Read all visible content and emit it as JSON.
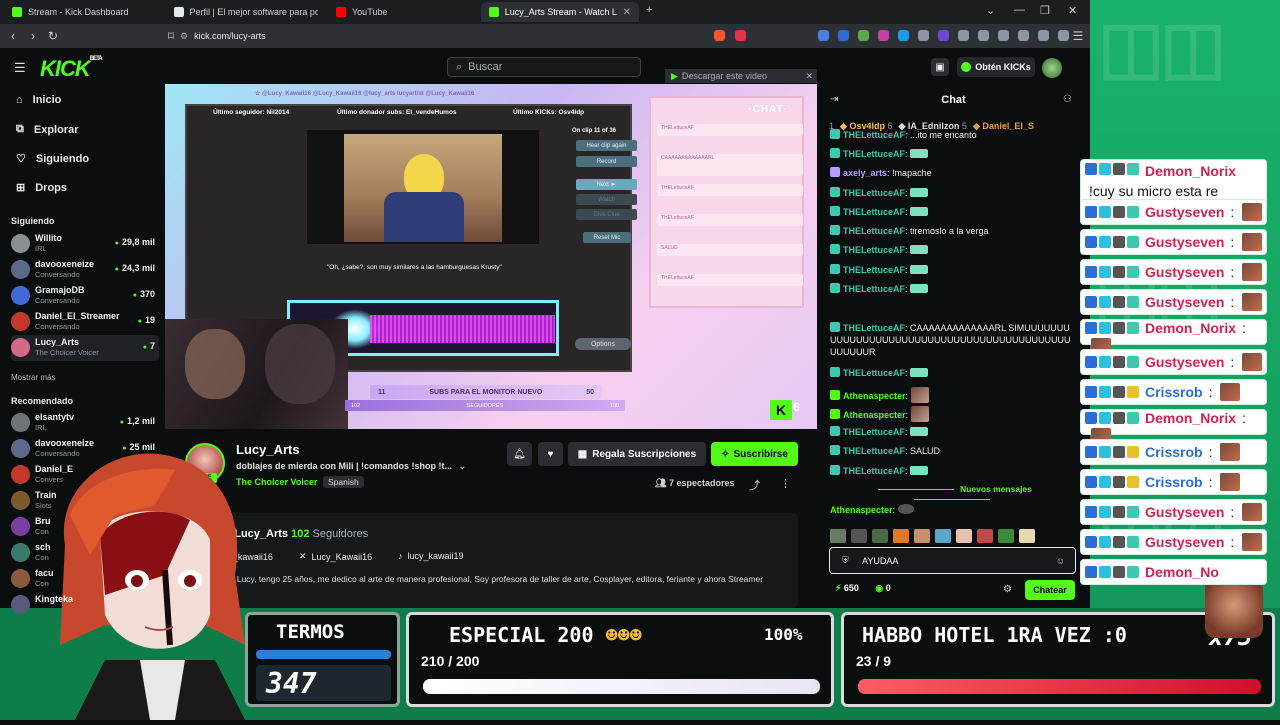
{
  "browser": {
    "tabs": [
      {
        "label": "Stream - Kick Dashboard",
        "color": "#53fc18"
      },
      {
        "label": "Perfil | El mejor software para potenc",
        "color": "#e8e8e8"
      },
      {
        "label": "YouTube",
        "color": "#ff0000"
      },
      {
        "label": "Lucy_Arts Stream - Watch Live",
        "color": "#53fc18"
      }
    ],
    "url": "kick.com/lucy-arts"
  },
  "header": {
    "logo": "KICK",
    "logo_badge": "BETA",
    "search_placeholder": "Buscar",
    "get_kicks": "Obtén KICKs"
  },
  "sidebar": {
    "nav": [
      {
        "label": "Inicio",
        "icon": "home-icon"
      },
      {
        "label": "Explorar",
        "icon": "compass-icon"
      },
      {
        "label": "Siguiendo",
        "icon": "heart-icon"
      },
      {
        "label": "Drops",
        "icon": "gift-icon"
      }
    ],
    "following_title": "Siguiendo",
    "following": [
      {
        "name": "Willito",
        "sub": "IRL",
        "viewers": "29,8 mil",
        "color": "#8a8f94"
      },
      {
        "name": "davooxeneize",
        "sub": "Conversando",
        "viewers": "24,3 mil",
        "color": "#5a6a88"
      },
      {
        "name": "GramajoDB",
        "sub": "Conversando",
        "viewers": "370",
        "color": "#3f6ad8"
      },
      {
        "name": "Daniel_El_Streamer",
        "sub": "Conversando",
        "viewers": "19",
        "color": "#c0392b"
      },
      {
        "name": "Lucy_Arts",
        "sub": "The Choicer Voicer",
        "viewers": "7",
        "color": "#d46a8a"
      }
    ],
    "show_more": "Mostrar más",
    "recommended_title": "Recomendado",
    "recommended": [
      {
        "name": "elsantytv",
        "sub": "IRL",
        "viewers": "1,2 mil",
        "color": "#6e7378"
      },
      {
        "name": "davooxeneize",
        "sub": "Conversando",
        "viewers": "25 mil",
        "color": "#5a6a88"
      },
      {
        "name": "Daniel_E",
        "sub": "Convers",
        "viewers": "",
        "color": "#c0392b"
      },
      {
        "name": "Train",
        "sub": "Slots",
        "viewers": "",
        "color": "#7b5a2d"
      },
      {
        "name": "Bru",
        "sub": "Con",
        "viewers": "",
        "color": "#7a3f9e"
      },
      {
        "name": "sch",
        "sub": "Con",
        "viewers": "",
        "color": "#3a7a6a"
      },
      {
        "name": "facu",
        "sub": "Con",
        "viewers": "",
        "color": "#8a5a3a"
      },
      {
        "name": "Kingteka",
        "sub": "",
        "viewers": "",
        "color": "#5a5a7a"
      }
    ]
  },
  "video": {
    "download": "Descargar este video",
    "handles_top": "☆ @Lucy_Kawaii16  @Lucy_Kawaii16  @lucy_arts  lucyartist  @Lucy_Kawaii16",
    "last_follower": "Último seguidor: Nil2014",
    "last_donor": "Último donador subs: El_vendeHumos",
    "last_kicks": "Último KICKs: Osv4ldp",
    "clip_counter": "On clip 11 of 36",
    "clip_buttons": [
      "Hear clip again",
      "Record",
      "Next ►",
      "Watch",
      "Give Clue",
      "Reset Mic"
    ],
    "subtitle": "\"Oh, ¿sabe?, son muy similares a las hamburguesas Krusty\"",
    "chat_label": "·CHAT·",
    "overlay_chat": [
      "THELettuceAF",
      "CAAAAAAAAAAAAARL",
      "THELettuceAF",
      "THELettuceAF",
      "SALUD",
      "THELettuceAF"
    ],
    "options": "Options",
    "subs_goal_label": "SUBS PARA EL MONITOR NUEVO",
    "subs_goal_current": "11",
    "subs_goal_target": "50",
    "sub_bar_left": "102",
    "sub_bar_mid": "SEGUIDORES",
    "sub_bar_right": "100",
    "kick_badge": "6"
  },
  "channel": {
    "name": "Lucy_Arts",
    "title": "doblajes de mierda con Mili | !comandos !shop !t...",
    "category": "The Choicer Voicer",
    "language": "Spanish",
    "live": "LIVE",
    "gift_label": "Regala Suscripciones",
    "subscribe_label": "Suscribirse",
    "viewers": "7 espectadores",
    "about_prefix": "Sobre Lucy_Arts",
    "followers_count": "102",
    "followers_label": "Seguidores",
    "socials": [
      {
        "icon": "instagram-icon",
        "handle": "lucy_kawaii16"
      },
      {
        "icon": "x-icon",
        "handle": "Lucy_Kawaii16"
      },
      {
        "icon": "tiktok-icon",
        "handle": "lucy_kawaii19"
      }
    ],
    "bio": "Me llamo Lucy, tengo 25 años, me dedico al arte de manera profesional, Soy profesora de taller de arte, Cosplayer, editora, feriante y ahora Streamer"
  },
  "chat": {
    "title": "Chat",
    "leaderboard": [
      {
        "name": "1",
        "amount": ""
      },
      {
        "name": "Osv4ldp",
        "amount": "6"
      },
      {
        "name": "IA_Ednilzon",
        "amount": "5"
      },
      {
        "name": "Daniel_El_S",
        "amount": ""
      }
    ],
    "messages": [
      {
        "user": "THELettuceAF",
        "text": "...ito me encanto",
        "color": "#3ec8b0"
      },
      {
        "user": "THELettuceAF",
        "text": "",
        "emote": true,
        "color": "#3ec8b0"
      },
      {
        "user": "axely_arts",
        "text": "!mapache",
        "color": "#b79cff"
      },
      {
        "user": "THELettuceAF",
        "text": "",
        "emote": true,
        "color": "#3ec8b0"
      },
      {
        "user": "THELettuceAF",
        "text": "",
        "emote": true,
        "color": "#3ec8b0"
      },
      {
        "user": "THELettuceAF",
        "text": "tiremoslo a la verga",
        "color": "#3ec8b0"
      },
      {
        "user": "THELettuceAF",
        "text": "",
        "emote": true,
        "color": "#3ec8b0"
      },
      {
        "user": "THELettuceAF",
        "text": "",
        "emote": true,
        "color": "#3ec8b0"
      },
      {
        "user": "THELettuceAF",
        "text": "",
        "emote": true,
        "color": "#3ec8b0"
      },
      {
        "user": "THELettuceAF",
        "text": "CAAAAAAAAAAAAARL SIMUUUUUUUUUUUUUUUUUUUUUUUUUUUUUUUUUUUUUUUUUUUUUUUUUUR",
        "color": "#3ec8b0"
      },
      {
        "user": "THELettuceAF",
        "text": "",
        "emote": true,
        "color": "#3ec8b0"
      },
      {
        "user": "Athenaspecter",
        "text": "",
        "pic": true,
        "color": "#53fc18"
      },
      {
        "user": "Athenaspecter",
        "text": "",
        "pic": true,
        "color": "#53fc18"
      },
      {
        "user": "THELettuceAF",
        "text": "",
        "emote": true,
        "color": "#3ec8b0"
      },
      {
        "user": "THELettuceAF",
        "text": "SALUD",
        "color": "#3ec8b0"
      },
      {
        "user": "THELettuceAF",
        "text": "",
        "emote": true,
        "color": "#3ec8b0"
      }
    ],
    "new_messages": "Nuevos mensajes",
    "last_user": "Athenaspecter",
    "input_value": "AYUDAA",
    "points": "650",
    "kicks": "0",
    "send_label": "Chatear"
  },
  "overlay_chat": [
    {
      "user": "Demon_Norix",
      "text": "!cuy su micro esta re saturado XD",
      "color": "#d2214f"
    },
    {
      "user": "Gustyseven",
      "text": ":",
      "color": "#d2214f"
    },
    {
      "user": "Gustyseven",
      "text": ":",
      "color": "#d2214f"
    },
    {
      "user": "Gustyseven",
      "text": ":",
      "color": "#d2214f"
    },
    {
      "user": "Gustyseven",
      "text": ":",
      "color": "#d2214f"
    },
    {
      "user": "Demon_Norix",
      "text": ":",
      "color": "#d2214f"
    },
    {
      "user": "Gustyseven",
      "text": ":",
      "color": "#d2214f"
    },
    {
      "user": "Crissrob",
      "text": ":",
      "color": "#2b6fd6"
    },
    {
      "user": "Demon_Norix",
      "text": ":",
      "color": "#d2214f"
    },
    {
      "user": "Crissrob",
      "text": ":",
      "color": "#2b6fd6"
    },
    {
      "user": "Crissrob",
      "text": ":",
      "color": "#2b6fd6"
    },
    {
      "user": "Gustyseven",
      "text": ":",
      "color": "#d2214f"
    },
    {
      "user": "Gustyseven",
      "text": ":",
      "color": "#d2214f"
    },
    {
      "user": "Demon_No",
      "text": "",
      "color": "#d2214f"
    }
  ],
  "bottom": {
    "termos_title": "TERMOS",
    "termos_value": "347",
    "especial_title": "ESPECIAL 200",
    "especial_percent": "100%",
    "especial_progress": "210 / 200",
    "especial_fraction": 1.0,
    "habbo_title": "HABBO HOTEL 1RA VEZ :0",
    "habbo_progress": "23 / 9",
    "habbo_multiplier": "x75",
    "habbo_fraction": 1.0
  }
}
